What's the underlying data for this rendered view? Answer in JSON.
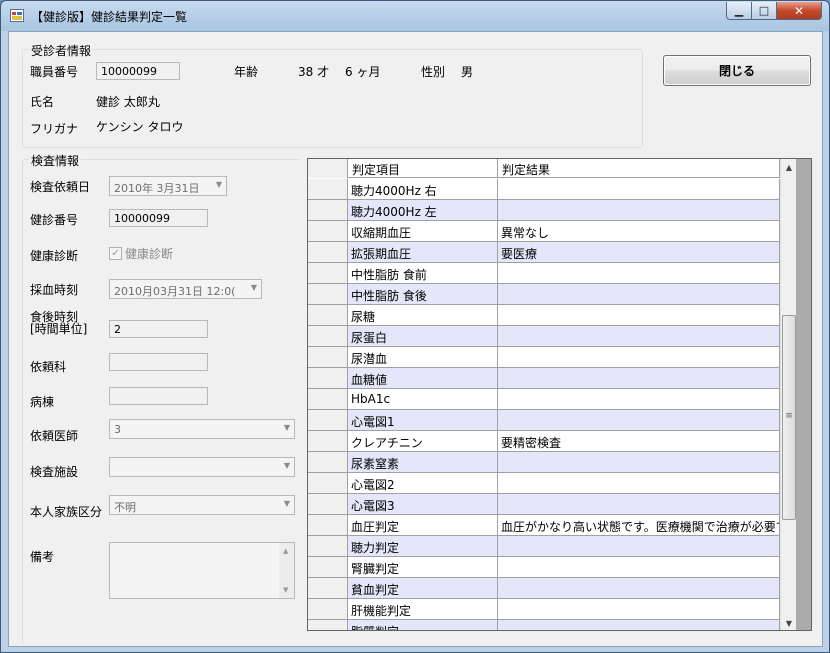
{
  "window": {
    "title": "【健診版】健診結果判定一覧",
    "controls": {
      "minimize": "▁",
      "maximize": "□",
      "close": "✕"
    }
  },
  "patient_group": {
    "legend": "受診者情報",
    "employee_no_label": "職員番号",
    "employee_no": "10000099",
    "age_label": "年齢",
    "age_years": "38 才",
    "age_months": "6 ヶ月",
    "sex_label": "性別",
    "sex": "男",
    "name_label": "氏名",
    "name": "健診 太郎丸",
    "furigana_label": "フリガナ",
    "furigana": "ケンシン タロウ"
  },
  "close_button": "閉じる",
  "exam_group": {
    "legend": "検査情報",
    "request_date_label": "検査依頼日",
    "request_date": "2010年  3月31日",
    "checkup_no_label": "健診番号",
    "checkup_no": "10000099",
    "health_check_label": "健康診断",
    "health_check_checkbox": "健康診断",
    "blood_time_label": "採血時刻",
    "blood_time": "2010月03月31日  12:0(",
    "postmeal_label_1": "食後時刻",
    "postmeal_label_2": "[時間単位]",
    "postmeal": "2",
    "dept_label": "依頼科",
    "dept": "",
    "ward_label": "病棟",
    "ward": "",
    "doctor_label": "依頼医師",
    "doctor": "3",
    "facility_label": "検査施設",
    "facility": "",
    "family_label": "本人家族区分",
    "family": "不明",
    "remarks_label": "備考"
  },
  "grid": {
    "headers": [
      "",
      "判定項目",
      "判定結果"
    ],
    "rows": [
      [
        "聴力4000Hz 右",
        ""
      ],
      [
        "聴力4000Hz 左",
        ""
      ],
      [
        "収縮期血圧",
        "異常なし"
      ],
      [
        "拡張期血圧",
        "要医療"
      ],
      [
        "中性脂肪 食前",
        ""
      ],
      [
        "中性脂肪 食後",
        ""
      ],
      [
        "尿糖",
        ""
      ],
      [
        "尿蛋白",
        ""
      ],
      [
        "尿潜血",
        ""
      ],
      [
        "血糖値",
        ""
      ],
      [
        "HbA1c",
        ""
      ],
      [
        "心電図1",
        ""
      ],
      [
        "クレアチニン",
        "要精密検査"
      ],
      [
        "尿素窒素",
        ""
      ],
      [
        "心電図2",
        ""
      ],
      [
        "心電図3",
        ""
      ],
      [
        "血圧判定",
        "血圧がかなり高い状態です。医療機関で治療が必要で..."
      ],
      [
        "聴力判定",
        ""
      ],
      [
        "腎臓判定",
        ""
      ],
      [
        "貧血判定",
        ""
      ],
      [
        "肝機能判定",
        ""
      ],
      [
        "脂質判定",
        ""
      ]
    ]
  }
}
